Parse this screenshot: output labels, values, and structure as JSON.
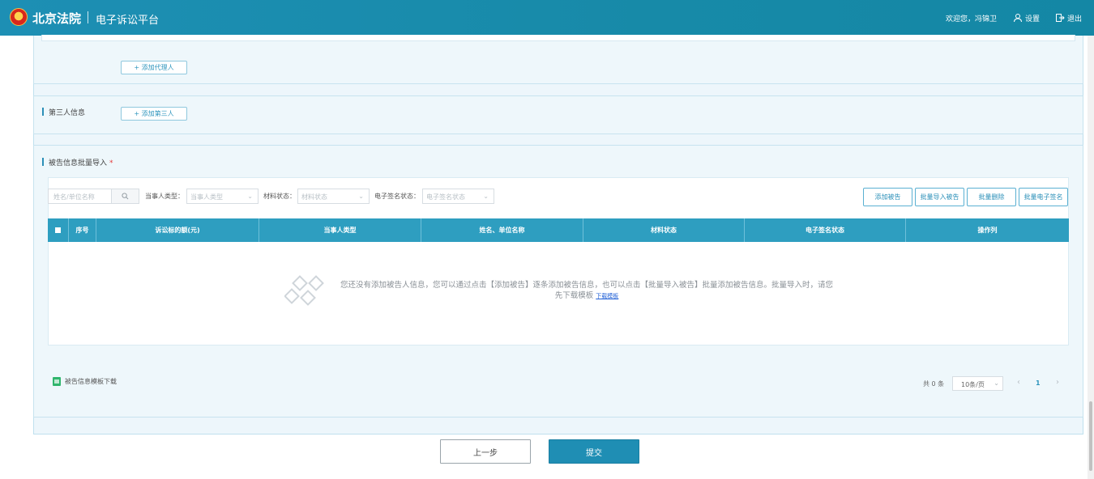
{
  "header": {
    "court_name": "北京法院",
    "platform_name": "电子诉讼平台",
    "welcome": "欢迎您，冯锦卫",
    "settings_label": "设置",
    "logout_label": "退出"
  },
  "agent_section": {
    "add_agent_button": "+ 添加代理人"
  },
  "third_party_section": {
    "title": "第三人信息",
    "add_third_party_button": "+ 添加第三人"
  },
  "defendant_section": {
    "title": "被告信息批量导入",
    "required_mark": "*",
    "filters": {
      "search_placeholder": "姓名/单位名称",
      "party_type_label": "当事人类型：",
      "party_type_placeholder": "当事人类型",
      "material_status_label": "材料状态：",
      "material_status_placeholder": "材料状态",
      "esign_status_label": "电子签名状态：",
      "esign_status_placeholder": "电子签名状态"
    },
    "toolbar": {
      "add_defendant": "添加被告",
      "batch_import": "批量导入被告",
      "batch_delete": "批量删除",
      "batch_esign": "批量电子签名"
    },
    "table": {
      "columns": [
        "序号",
        "诉讼标的额(元)",
        "当事人类型",
        "姓名、单位名称",
        "材料状态",
        "电子签名状态",
        "操作列"
      ],
      "rows": []
    },
    "empty_state": {
      "message": "您还没有添加被告人信息，您可以通过点击【添加被告】逐条添加被告信息，也可以点击【批量导入被告】批量添加被告信息。批量导入时，请您先下载模板",
      "download_link": "下载模板"
    },
    "template_download": "被告信息模板下载",
    "pagination": {
      "total": "共 0 条",
      "page_size": "10条/页",
      "prev": "‹",
      "current_page": "1",
      "next": "›"
    }
  },
  "footer": {
    "prev_button": "上一步",
    "submit_button": "提交"
  },
  "colors": {
    "header_bg": "#1a8db0",
    "table_header": "#2e9ec0",
    "submit_bg": "#1f8eb4",
    "panel_bg": "#eef7fb"
  }
}
